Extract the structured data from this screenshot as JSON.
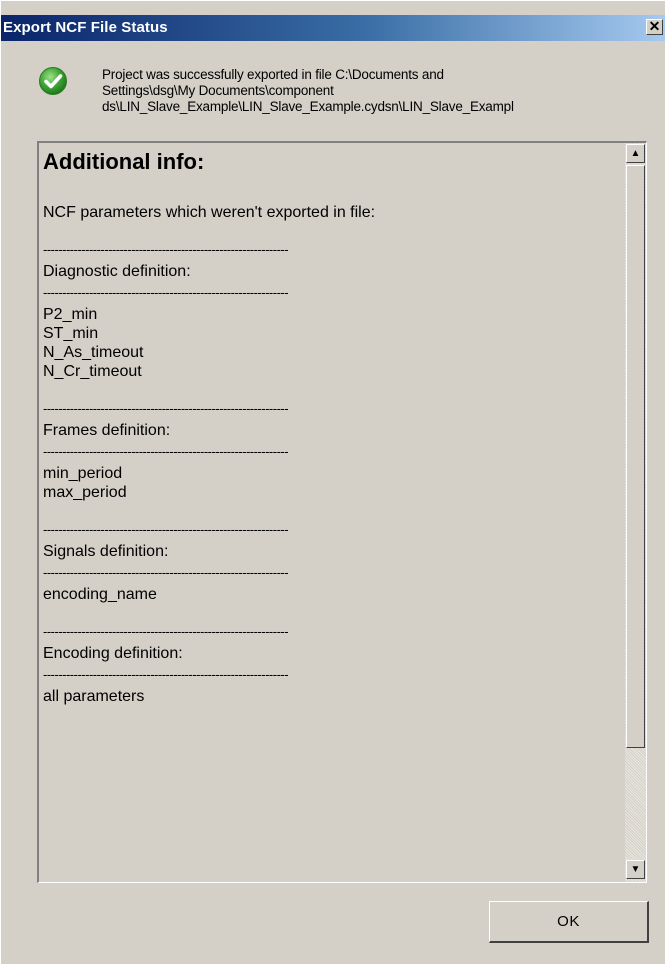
{
  "window": {
    "title": "Export NCF File Status",
    "close_glyph": "✕"
  },
  "status": {
    "icon": "success-check-icon",
    "icon_color": "#3aa532",
    "message": "Project was successfully exported in file C:\\Documents and\nSettings\\dsg\\My Documents\\component\nds\\LIN_Slave_Example\\LIN_Slave_Example.cydsn\\LIN_Slave_Exampl"
  },
  "info": {
    "heading": "Additional info:",
    "intro": "NCF parameters which weren't exported in file:",
    "separator": "----------------------------------------------------------------",
    "sections": [
      {
        "title": "Diagnostic definition:",
        "items": [
          "P2_min",
          "ST_min",
          "N_As_timeout",
          "N_Cr_timeout"
        ]
      },
      {
        "title": "Frames definition:",
        "items": [
          "min_period",
          "max_period"
        ]
      },
      {
        "title": "Signals definition:",
        "items": [
          "encoding_name"
        ]
      },
      {
        "title": "Encoding definition:",
        "items": [
          "all parameters"
        ]
      }
    ]
  },
  "scrollbar": {
    "up_glyph": "▲",
    "down_glyph": "▼"
  },
  "buttons": {
    "ok_label": "OK"
  }
}
